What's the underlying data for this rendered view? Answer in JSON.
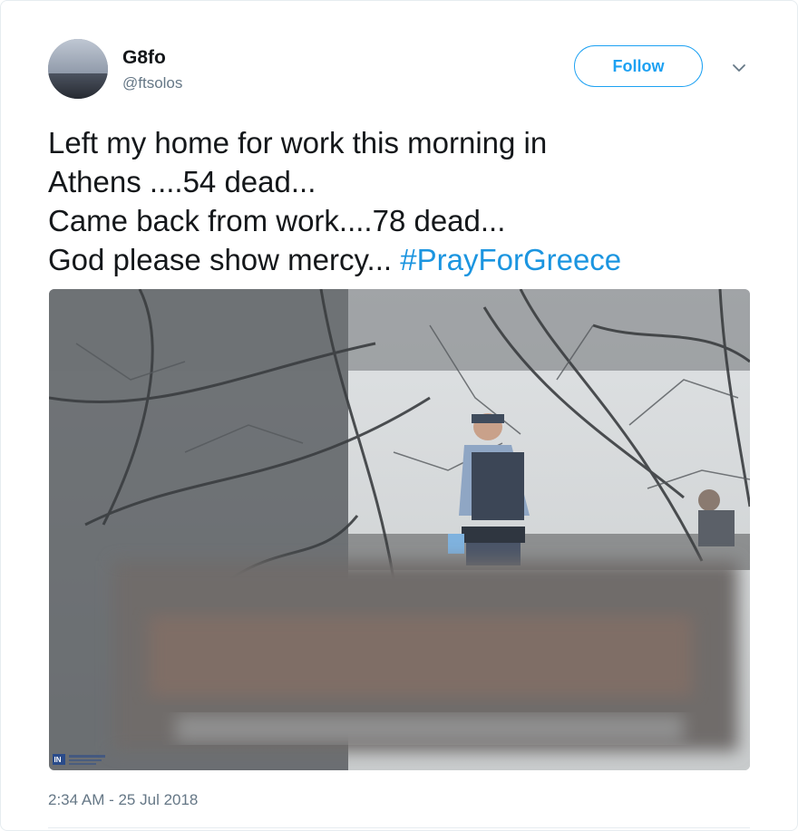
{
  "user": {
    "name": "G8fo",
    "handle": "@ftsolos"
  },
  "actions": {
    "follow_label": "Follow",
    "menu_icon": "chevron-down-icon"
  },
  "tweet": {
    "line1": "Left my home for work this morning in",
    "line2": "Athens ....54 dead...",
    "line3": "Came back from work....78 dead...",
    "line4": "God please show mercy...",
    "hashtag": "#PrayForGreece"
  },
  "media": {
    "watermark": "IN"
  },
  "meta": {
    "timestamp": "2:34 AM - 25 Jul 2018"
  },
  "colors": {
    "accent": "#1da1f2",
    "hashtag": "#1b95e0",
    "secondary_text": "#657786"
  }
}
